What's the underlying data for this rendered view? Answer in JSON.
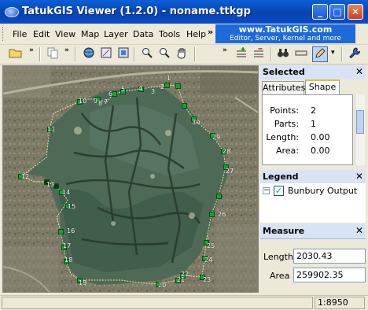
{
  "window": {
    "title": "TatukGIS Viewer (1.2.0) - noname.ttkgp",
    "minimize": "_",
    "maximize": "□",
    "close": "✕"
  },
  "menu": {
    "items": [
      "File",
      "Edit",
      "View",
      "Map",
      "Layer",
      "Data",
      "Tools",
      "Help"
    ],
    "overflow": "»"
  },
  "banner": {
    "line1": "www.TatukGIS.com",
    "line2": "Editor, Server, Kernel and more"
  },
  "toolbar": {
    "overflow": "»",
    "icons": [
      "open-folder-icon",
      "copy-icon",
      "globe-icon",
      "extent-icon",
      "layer-icon",
      "zoom-window-icon",
      "zoom-icon",
      "pan-hand-icon",
      "add-layer-icon",
      "remove-layer-icon",
      "binoculars-icon",
      "measure-icon",
      "edit-pencil-icon",
      "wrench-icon"
    ],
    "active": "edit-pencil-icon",
    "dropdown": "▾"
  },
  "map": {
    "vertex_labels": [
      "1",
      "2",
      "3",
      "4",
      "5",
      "6",
      "7",
      "8",
      "9",
      "10",
      "11",
      "12",
      "13",
      "14",
      "15",
      "16",
      "17",
      "18",
      "19",
      "20",
      "21",
      "22",
      "23",
      "24",
      "25",
      "26",
      "27",
      "28",
      "29",
      "30"
    ]
  },
  "selected_panel": {
    "title": "Selected",
    "close": "✕",
    "tabs": [
      "Attributes",
      "Shape"
    ],
    "active_tab": "Shape",
    "stats": [
      {
        "label": "Points:",
        "value": "2"
      },
      {
        "label": "Parts:",
        "value": "1"
      },
      {
        "label": "Length:",
        "value": "0.00"
      },
      {
        "label": "Area:",
        "value": "0.00"
      }
    ]
  },
  "legend_panel": {
    "title": "Legend",
    "close": "✕",
    "layer_name": "Bunbury Output",
    "layer_visible": true,
    "expand": "−",
    "check": "✓"
  },
  "measure_panel": {
    "title": "Measure",
    "close": "✕",
    "length_label": "Length :",
    "length_value": "2030.43",
    "area_label": "Area :",
    "area_value": "259902.35"
  },
  "statusbar": {
    "scale": "1:8950"
  },
  "colors": {
    "titlebar": "#0842b0",
    "vertex": "#17a03a",
    "panel_header": "#d8e3f5"
  }
}
